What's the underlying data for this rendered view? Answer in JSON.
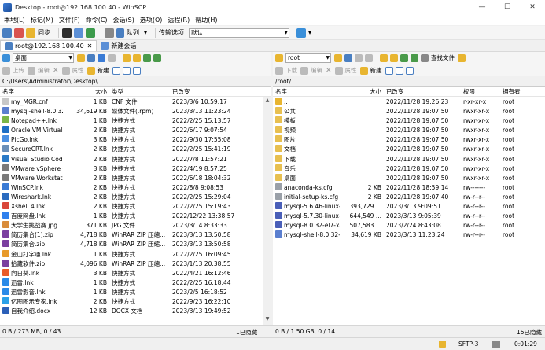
{
  "window": {
    "title": "Desktop - root@192.168.100.40 - WinSCP",
    "controls": [
      "—",
      "☐",
      "✕"
    ]
  },
  "menu": [
    "本地(L)",
    "标记(M)",
    "文件(F)",
    "命令(C)",
    "会话(S)",
    "选项(O)",
    "远程(R)",
    "帮助(H)"
  ],
  "toolbar": {
    "sync": "同步",
    "queue": "队列",
    "transfer_label": "传输选项",
    "transfer_value": "默认"
  },
  "tabs": {
    "session": "root@192.168.100.40",
    "new_session": "新建会话"
  },
  "left": {
    "drive": "桌面",
    "path": "C:\\Users\\Administrator\\Desktop\\",
    "actions": {
      "upload": "上传",
      "edit": "编辑",
      "props": "属性",
      "new": "新建"
    },
    "columns": [
      "名字",
      "大小",
      "类型",
      "已改变"
    ],
    "files": [
      {
        "name": "my_MGR.cnf",
        "size": "1 KB",
        "type": "CNF 文件",
        "changed": "2023/3/6 10:59:17",
        "icon": "file-icon"
      },
      {
        "name": "mysql-shell-8.0.32-...",
        "size": "34,619 KB",
        "type": "媒体文件(.rpm)",
        "changed": "2023/3/13 11:23:24",
        "icon": "rpm-icon"
      },
      {
        "name": "Notepad++.lnk",
        "size": "1 KB",
        "type": "快捷方式",
        "changed": "2022/2/25 15:13:57",
        "icon": "notepad-icon"
      },
      {
        "name": "Oracle VM VirtualBo...",
        "size": "2 KB",
        "type": "快捷方式",
        "changed": "2022/6/17 9:07:54",
        "icon": "vbox-icon"
      },
      {
        "name": "PicGo.lnk",
        "size": "3 KB",
        "type": "快捷方式",
        "changed": "2022/9/30 17:55:08",
        "icon": "picgo-icon"
      },
      {
        "name": "SecureCRT.lnk",
        "size": "2 KB",
        "type": "快捷方式",
        "changed": "2022/2/25 15:41:19",
        "icon": "securecrt-icon"
      },
      {
        "name": "Visual Studio Code.l...",
        "size": "2 KB",
        "type": "快捷方式",
        "changed": "2022/7/8 11:57:21",
        "icon": "vscode-icon"
      },
      {
        "name": "VMware vSphere Cli...",
        "size": "3 KB",
        "type": "快捷方式",
        "changed": "2022/4/19 8:57:25",
        "icon": "vmware-icon"
      },
      {
        "name": "VMware Workstatio...",
        "size": "2 KB",
        "type": "快捷方式",
        "changed": "2022/6/18 18:04:32",
        "icon": "vmware-icon"
      },
      {
        "name": "WinSCP.lnk",
        "size": "2 KB",
        "type": "快捷方式",
        "changed": "2022/8/8 9:08:53",
        "icon": "winscp-icon"
      },
      {
        "name": "Wireshark.lnk",
        "size": "2 KB",
        "type": "快捷方式",
        "changed": "2022/2/25 15:29:04",
        "icon": "wireshark-icon"
      },
      {
        "name": "Xshell 4.lnk",
        "size": "2 KB",
        "type": "快捷方式",
        "changed": "2022/2/25 15:19:43",
        "icon": "xshell-icon"
      },
      {
        "name": "百度网盘.lnk",
        "size": "1 KB",
        "type": "快捷方式",
        "changed": "2022/12/22 13:38:57",
        "icon": "baidu-icon"
      },
      {
        "name": "大学生挑战赛.jpg",
        "size": "371 KB",
        "type": "JPG 文件",
        "changed": "2023/3/14 8:33:33",
        "icon": "image-icon"
      },
      {
        "name": "简历集合(1).zip",
        "size": "4,718 KB",
        "type": "WinRAR ZIP 压缩...",
        "changed": "2023/3/13 13:50:58",
        "icon": "zip-icon"
      },
      {
        "name": "简历集合.zip",
        "size": "4,718 KB",
        "type": "WinRAR ZIP 压缩...",
        "changed": "2023/3/13 13:50:58",
        "icon": "zip-icon"
      },
      {
        "name": "金山打字通.lnk",
        "size": "1 KB",
        "type": "快捷方式",
        "changed": "2022/2/25 16:09:45",
        "icon": "typing-icon"
      },
      {
        "name": "拾藏软件.zip",
        "size": "4,096 KB",
        "type": "WinRAR ZIP 压缩...",
        "changed": "2023/1/13 20:38:55",
        "icon": "zip-icon"
      },
      {
        "name": "向日葵.lnk",
        "size": "3 KB",
        "type": "快捷方式",
        "changed": "2022/4/21 16:12:46",
        "icon": "sunflower-icon"
      },
      {
        "name": "迅雷.lnk",
        "size": "1 KB",
        "type": "快捷方式",
        "changed": "2022/2/25 16:18:44",
        "icon": "xunlei-icon"
      },
      {
        "name": "迅雷影音.lnk",
        "size": "1 KB",
        "type": "快捷方式",
        "changed": "2023/2/5 16:18:52",
        "icon": "xunlei-icon"
      },
      {
        "name": "亿图图示专家.lnk",
        "size": "2 KB",
        "type": "快捷方式",
        "changed": "2022/9/23 16:22:10",
        "icon": "edraw-icon"
      },
      {
        "name": "自我介绍.docx",
        "size": "12 KB",
        "type": "DOCX 文档",
        "changed": "2023/3/13 19:49:52",
        "icon": "docx-icon"
      }
    ],
    "status": "0 B / 273 MB, 0 / 43",
    "hidden": "1已隐藏"
  },
  "right": {
    "dir": "root",
    "path": "/root/",
    "actions": {
      "download": "下载",
      "edit": "编辑",
      "props": "属性",
      "new": "新建",
      "find": "查找文件"
    },
    "columns": [
      "名字",
      "大小",
      "已改变",
      "权限",
      "拥有者"
    ],
    "files": [
      {
        "name": "..",
        "size": "",
        "changed": "2022/11/28 19:26:23",
        "rights": "r-xr-xr-x",
        "owner": "root",
        "icon": "parent-icon"
      },
      {
        "name": "公共",
        "size": "",
        "changed": "2022/11/28 19:07:50",
        "rights": "rwxr-xr-x",
        "owner": "root",
        "icon": "folder-icon"
      },
      {
        "name": "模板",
        "size": "",
        "changed": "2022/11/28 19:07:50",
        "rights": "rwxr-xr-x",
        "owner": "root",
        "icon": "folder-icon"
      },
      {
        "name": "视频",
        "size": "",
        "changed": "2022/11/28 19:07:50",
        "rights": "rwxr-xr-x",
        "owner": "root",
        "icon": "folder-icon"
      },
      {
        "name": "图片",
        "size": "",
        "changed": "2022/11/28 19:07:50",
        "rights": "rwxr-xr-x",
        "owner": "root",
        "icon": "folder-icon"
      },
      {
        "name": "文档",
        "size": "",
        "changed": "2022/11/28 19:07:50",
        "rights": "rwxr-xr-x",
        "owner": "root",
        "icon": "folder-icon"
      },
      {
        "name": "下载",
        "size": "",
        "changed": "2022/11/28 19:07:50",
        "rights": "rwxr-xr-x",
        "owner": "root",
        "icon": "folder-icon"
      },
      {
        "name": "音乐",
        "size": "",
        "changed": "2022/11/28 19:07:50",
        "rights": "rwxr-xr-x",
        "owner": "root",
        "icon": "folder-icon"
      },
      {
        "name": "桌面",
        "size": "",
        "changed": "2022/11/28 19:07:50",
        "rights": "rwxr-xr-x",
        "owner": "root",
        "icon": "folder-icon"
      },
      {
        "name": "anaconda-ks.cfg",
        "size": "2 KB",
        "changed": "2022/11/28 18:59:14",
        "rights": "rw-------",
        "owner": "root",
        "icon": "cfg-icon"
      },
      {
        "name": "initial-setup-ks.cfg",
        "size": "2 KB",
        "changed": "2022/11/28 19:07:40",
        "rights": "rw-r--r--",
        "owner": "root",
        "icon": "cfg-icon"
      },
      {
        "name": "mysql-5.6.46-linux-...",
        "size": "393,729 ...",
        "changed": "2023/3/13 9:09:51",
        "rights": "rw-r--r--",
        "owner": "root",
        "icon": "archive-icon"
      },
      {
        "name": "mysql-5.7.30-linux-...",
        "size": "644,549 ...",
        "changed": "2023/3/13 9:05:39",
        "rights": "rw-r--r--",
        "owner": "root",
        "icon": "archive-icon"
      },
      {
        "name": "mysql-8.0.32-el7-x8...",
        "size": "507,583 ...",
        "changed": "2023/2/24 8:43:08",
        "rights": "rw-r--r--",
        "owner": "root",
        "icon": "archive-icon"
      },
      {
        "name": "mysql-shell-8.0.32-...",
        "size": "34,619 KB",
        "changed": "2023/3/13 11:23:24",
        "rights": "rw-r--r--",
        "owner": "root",
        "icon": "rpm-icon"
      }
    ],
    "status": "0 B / 1.50 GB, 0 / 14",
    "hidden": "15已隐藏"
  },
  "bottom": {
    "protocol": "SFTP-3",
    "time": "0:01:29"
  }
}
